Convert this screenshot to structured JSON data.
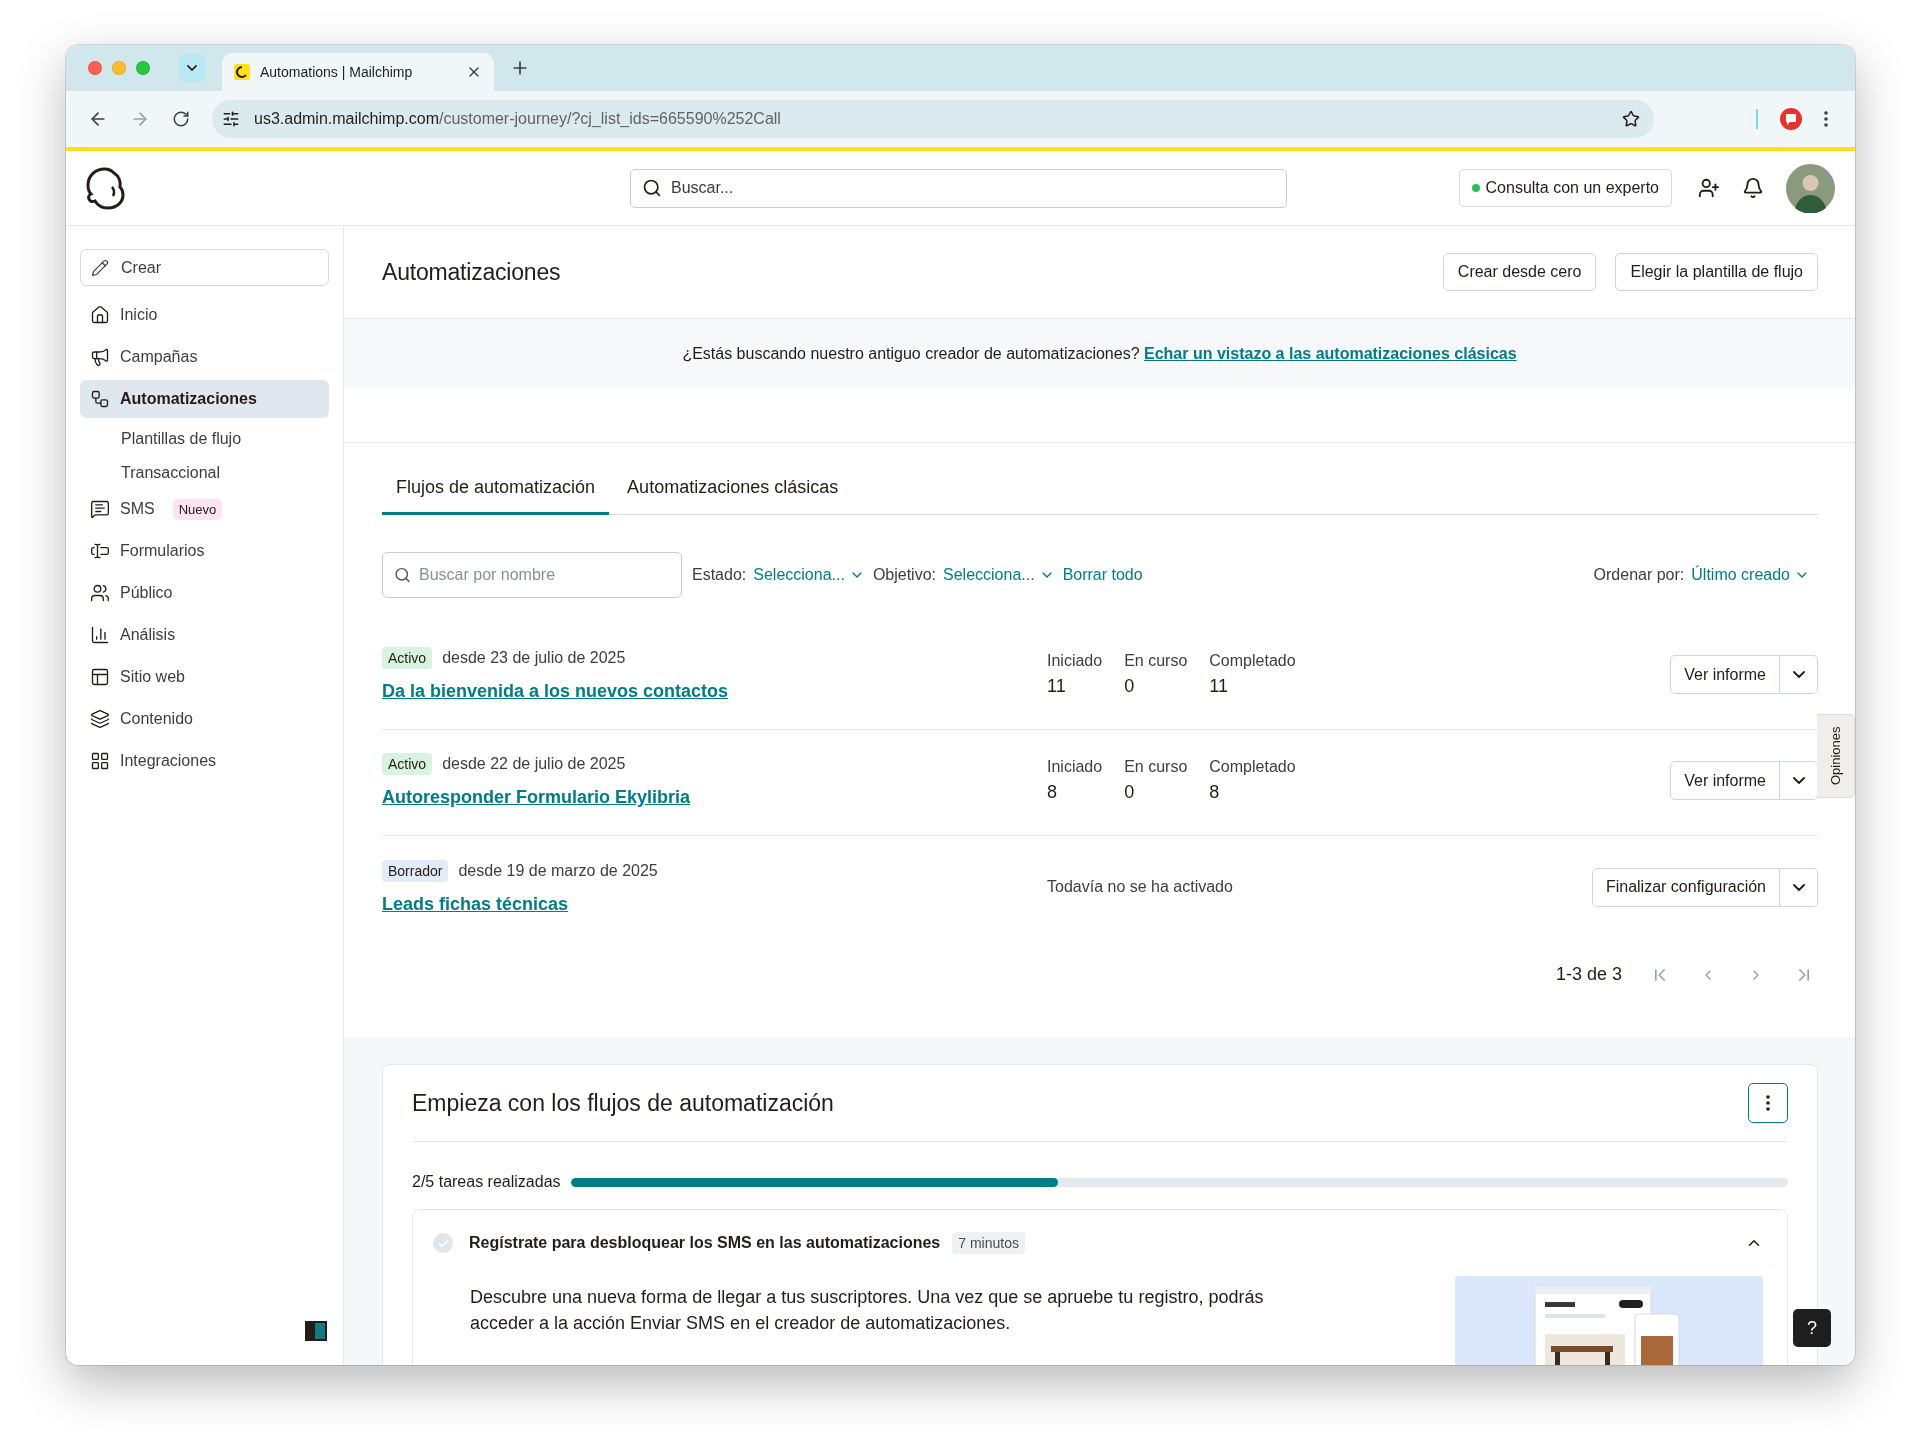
{
  "browser": {
    "tab_title": "Automations | Mailchimp",
    "url_host": "us3.admin.mailchimp.com",
    "url_path": "/customer-journey/?cj_list_ids=665590%252Call"
  },
  "header": {
    "search_placeholder": "Buscar...",
    "expert_button": "Consulta con un experto"
  },
  "sidebar": {
    "create": "Crear",
    "items": [
      {
        "label": "Inicio",
        "selected": false
      },
      {
        "label": "Campañas",
        "selected": false
      },
      {
        "label": "Automatizaciones",
        "selected": true,
        "children": [
          {
            "label": "Plantillas de flujo",
            "selected": false
          },
          {
            "label": "Transaccional",
            "selected": false
          }
        ]
      },
      {
        "label": "SMS",
        "selected": false,
        "badge": "Nuevo"
      },
      {
        "label": "Formularios",
        "selected": false
      },
      {
        "label": "Público",
        "selected": false
      },
      {
        "label": "Análisis",
        "selected": false
      },
      {
        "label": "Sitio web",
        "selected": false
      },
      {
        "label": "Contenido",
        "selected": false
      },
      {
        "label": "Integraciones",
        "selected": false
      }
    ]
  },
  "page": {
    "title": "Automatizaciones",
    "buttons": [
      "Crear desde cero",
      "Elegir la plantilla de flujo"
    ],
    "banner": {
      "text": "¿Estás buscando nuestro antiguo creador de automatizaciones?",
      "link": "Echar un vistazo a las automatizaciones clásicas"
    },
    "tabs": [
      {
        "label": "Flujos de automatización",
        "selected": true
      },
      {
        "label": "Automatizaciones clásicas",
        "selected": false
      }
    ],
    "filters": {
      "search_placeholder": "Buscar por nombre",
      "status_label": "Estado:",
      "status_value": "Selecciona...",
      "goal_label": "Objetivo:",
      "goal_value": "Selecciona...",
      "clear": "Borrar todo",
      "sort_label": "Ordenar por:",
      "sort_value": "Último creado"
    }
  },
  "flows": [
    {
      "status": "Activo",
      "kind": "active",
      "since": "desde 23 de julio de 2025",
      "name": "Da la bienvenida a los nuevos contactos",
      "stats": [
        {
          "label": "Iniciado",
          "value": "11"
        },
        {
          "label": "En curso",
          "value": "0"
        },
        {
          "label": "Completado",
          "value": "11"
        }
      ],
      "action": "Ver informe"
    },
    {
      "status": "Activo",
      "kind": "active",
      "since": "desde 22 de julio de 2025",
      "name": "Autoresponder Formulario Ekylibria",
      "stats": [
        {
          "label": "Iniciado",
          "value": "8"
        },
        {
          "label": "En curso",
          "value": "0"
        },
        {
          "label": "Completado",
          "value": "8"
        }
      ],
      "action": "Ver informe"
    },
    {
      "status": "Borrador",
      "kind": "draft",
      "since": "desde 19 de marzo de 2025",
      "name": "Leads fichas técnicas",
      "note": "Todavía no se ha activado",
      "action": "Finalizar configuración"
    }
  ],
  "pagination": {
    "range": "1-3 de 3"
  },
  "onboarding": {
    "title": "Empieza con los flujos de automatización",
    "progress_label": "2/5 tareas realizadas",
    "level": 0.4,
    "task": {
      "title": "Regístrate para desbloquear los SMS en las automatizaciones",
      "duration": "7 minutos",
      "done": false,
      "expanded": true,
      "description": "Descubre una nueva forma de llegar a tus suscriptores. Una vez que se apruebe tu registro, podrás acceder a la acción Enviar SMS en el creador de automatizaciones."
    }
  },
  "feedback_tab": "Opiniones",
  "help_button": "?"
}
